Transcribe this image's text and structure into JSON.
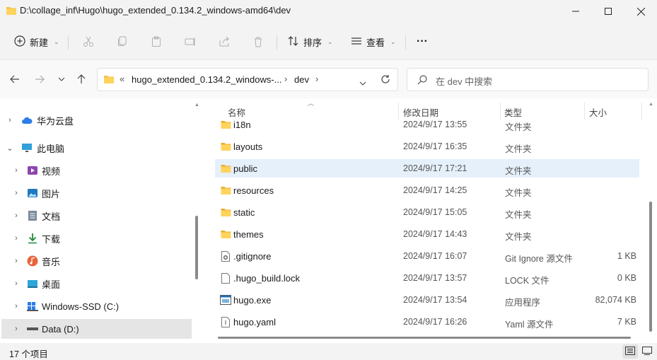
{
  "window": {
    "title": "D:\\collage_inf\\Hugo\\hugo_extended_0.134.2_windows-amd64\\dev"
  },
  "toolbar": {
    "new_label": "新建",
    "sort_label": "排序",
    "view_label": "查看",
    "more_label": "···"
  },
  "address": {
    "overflow": "«",
    "crumb1": "hugo_extended_0.134.2_windows-...",
    "sep": "›",
    "crumb2": "dev"
  },
  "search": {
    "placeholder": "在 dev 中搜索"
  },
  "sidebar": {
    "items": [
      {
        "label": "华为云盘",
        "icon": "cloud-icon"
      },
      {
        "label": "此电脑",
        "icon": "computer-icon"
      },
      {
        "label": "视频",
        "icon": "video-icon"
      },
      {
        "label": "图片",
        "icon": "pictures-icon"
      },
      {
        "label": "文档",
        "icon": "document-icon"
      },
      {
        "label": "下载",
        "icon": "download-icon"
      },
      {
        "label": "音乐",
        "icon": "music-icon"
      },
      {
        "label": "桌面",
        "icon": "desktop-icon"
      },
      {
        "label": "Windows-SSD (C:)",
        "icon": "drive-icon"
      },
      {
        "label": "Data (D:)",
        "icon": "drive-icon"
      }
    ]
  },
  "columns": {
    "name": "名称",
    "modified": "修改日期",
    "type": "类型",
    "size": "大小"
  },
  "files": [
    {
      "name": "i18n",
      "date": "2024/9/17 13:55",
      "type": "文件夹",
      "size": "",
      "icon": "folder-icon"
    },
    {
      "name": "layouts",
      "date": "2024/9/17 16:35",
      "type": "文件夹",
      "size": "",
      "icon": "folder-icon"
    },
    {
      "name": "public",
      "date": "2024/9/17 17:21",
      "type": "文件夹",
      "size": "",
      "icon": "folder-icon"
    },
    {
      "name": "resources",
      "date": "2024/9/17 14:25",
      "type": "文件夹",
      "size": "",
      "icon": "folder-icon"
    },
    {
      "name": "static",
      "date": "2024/9/17 15:05",
      "type": "文件夹",
      "size": "",
      "icon": "folder-icon"
    },
    {
      "name": "themes",
      "date": "2024/9/17 14:43",
      "type": "文件夹",
      "size": "",
      "icon": "folder-icon"
    },
    {
      "name": ".gitignore",
      "date": "2024/9/17 16:07",
      "type": "Git Ignore 源文件",
      "size": "1 KB",
      "icon": "gear-file-icon"
    },
    {
      "name": ".hugo_build.lock",
      "date": "2024/9/17 13:57",
      "type": "LOCK 文件",
      "size": "0 KB",
      "icon": "file-icon"
    },
    {
      "name": "hugo.exe",
      "date": "2024/9/17 13:54",
      "type": "应用程序",
      "size": "82,074 KB",
      "icon": "exe-icon"
    },
    {
      "name": "hugo.yaml",
      "date": "2024/9/17 16:26",
      "type": "Yaml 源文件",
      "size": "7 KB",
      "icon": "text-file-icon"
    }
  ],
  "status": {
    "count": "17 个项目"
  },
  "colors": {
    "folder": "#f4c24a",
    "selected_row": "#e5f0fb",
    "accent": "#0067c0"
  }
}
